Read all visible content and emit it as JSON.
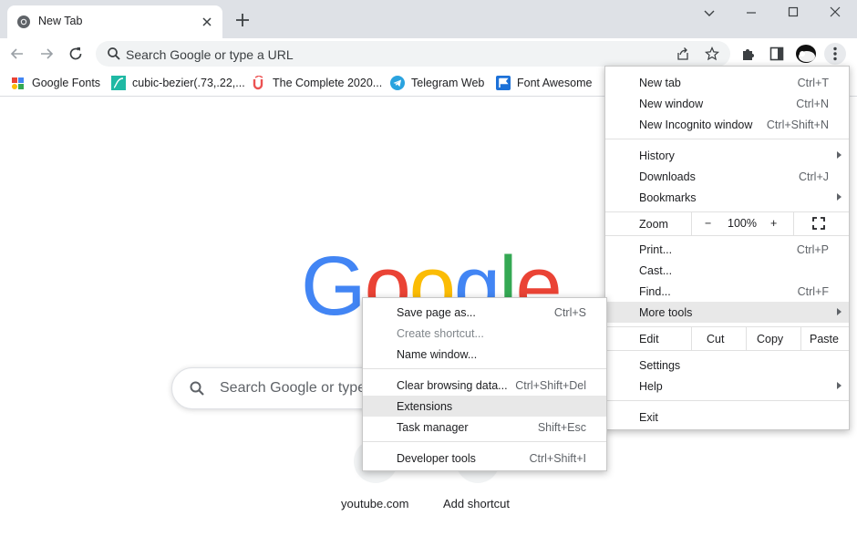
{
  "tab": {
    "title": "New Tab"
  },
  "omnibox": {
    "placeholder": "Search Google or type a URL"
  },
  "bookmarks": [
    {
      "label": "Google Fonts",
      "icon": "google-fonts-icon"
    },
    {
      "label": "cubic-bezier(.73,.22,...",
      "icon": "cubic-bezier-icon"
    },
    {
      "label": "The Complete 2020...",
      "icon": "udemy-icon"
    },
    {
      "label": "Telegram Web",
      "icon": "telegram-icon"
    },
    {
      "label": "Font Awesome",
      "icon": "font-awesome-icon"
    }
  ],
  "ntp": {
    "logo": [
      "G",
      "o",
      "o",
      "g",
      "l",
      "e"
    ],
    "search_placeholder": "Search Google or type a URL",
    "shortcuts": [
      {
        "label": "youtube.com"
      },
      {
        "label": "Add shortcut"
      }
    ]
  },
  "menu": {
    "new_tab": {
      "label": "New tab",
      "shortcut": "Ctrl+T"
    },
    "new_window": {
      "label": "New window",
      "shortcut": "Ctrl+N"
    },
    "new_incognito": {
      "label": "New Incognito window",
      "shortcut": "Ctrl+Shift+N"
    },
    "history": {
      "label": "History"
    },
    "downloads": {
      "label": "Downloads",
      "shortcut": "Ctrl+J"
    },
    "bookmarks": {
      "label": "Bookmarks"
    },
    "zoom": {
      "label": "Zoom",
      "minus": "−",
      "value": "100%",
      "plus": "+"
    },
    "print": {
      "label": "Print...",
      "shortcut": "Ctrl+P"
    },
    "cast": {
      "label": "Cast..."
    },
    "find": {
      "label": "Find...",
      "shortcut": "Ctrl+F"
    },
    "more_tools": {
      "label": "More tools"
    },
    "edit": {
      "label": "Edit",
      "cut": "Cut",
      "copy": "Copy",
      "paste": "Paste"
    },
    "settings": {
      "label": "Settings"
    },
    "help": {
      "label": "Help"
    },
    "exit": {
      "label": "Exit"
    }
  },
  "submenu": {
    "save_page": {
      "label": "Save page as...",
      "shortcut": "Ctrl+S"
    },
    "create_shortcut": {
      "label": "Create shortcut..."
    },
    "name_window": {
      "label": "Name window..."
    },
    "clear_data": {
      "label": "Clear browsing data...",
      "shortcut": "Ctrl+Shift+Del"
    },
    "extensions": {
      "label": "Extensions"
    },
    "task_manager": {
      "label": "Task manager",
      "shortcut": "Shift+Esc"
    },
    "dev_tools": {
      "label": "Developer tools",
      "shortcut": "Ctrl+Shift+I"
    }
  },
  "colors": {
    "google_blue": "#4285f4",
    "google_red": "#ea4335",
    "google_yellow": "#fbbc05",
    "google_green": "#34a853",
    "tabstrip": "#dee1e6",
    "highlight": "#e8e8e8"
  }
}
